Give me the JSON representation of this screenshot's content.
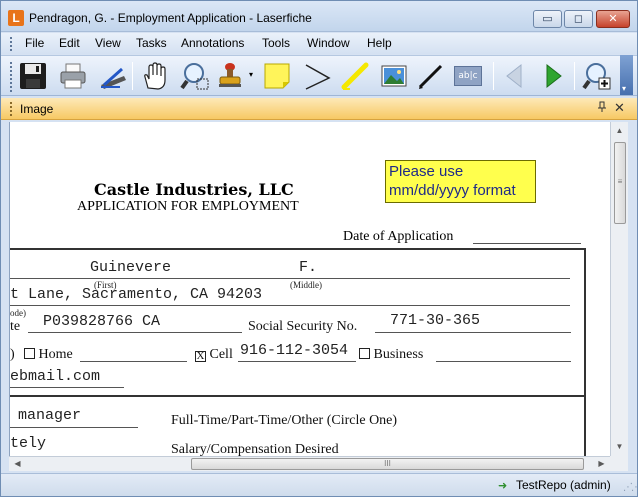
{
  "window": {
    "app_icon_letter": "L",
    "title": "Pendragon, G. - Employment Application - Laserfiche",
    "minimize_glyph": "▭",
    "maximize_glyph": "◻",
    "close_glyph": "✕"
  },
  "menu": {
    "items": [
      "File",
      "Edit",
      "View",
      "Tasks",
      "Annotations",
      "Tools",
      "Window",
      "Help"
    ]
  },
  "toolbar": {
    "tools": [
      "save-icon",
      "print-icon",
      "scan-icon",
      "pan-hand-icon",
      "zoom-rect-icon",
      "stamp-icon",
      "sticky-note-icon",
      "pointer-arrow-icon",
      "highlighter-icon",
      "image-icon",
      "pen-icon",
      "text-box-icon",
      "previous-page-icon",
      "next-page-icon",
      "zoom-in-icon"
    ],
    "textbox_glyph": "ab|c",
    "overflow_glyph": "▾"
  },
  "panel": {
    "title": "Image",
    "pin_glyph": "📌",
    "close_glyph": "✕"
  },
  "document": {
    "company": "Castle Industries, LLC",
    "subtitle": "APPLICATION FOR EMPLOYMENT",
    "date_label": "Date of Application",
    "first_name": "Guinevere",
    "middle_initial": "F.",
    "first_label": "(First)",
    "middle_label": "(Middle)",
    "address": "t Lane, Sacramento, CA 94203",
    "code_label": "ode)",
    "license_prefix": "te",
    "license_number": "P039828766 CA",
    "ssn_label": "Social Security No.",
    "ssn_value": "771-30-365",
    "phone_paren": ")",
    "home_label": "Home",
    "cell_check": "X",
    "cell_label": "Cell",
    "cell_number": "916-112-3054",
    "business_label": "Business",
    "email_fragment": "ebmail.com",
    "position": "manager",
    "employment_type_label": "Full-Time/Part-Time/Other (Circle One)",
    "start": "tely",
    "salary_label": "Salary/Compensation Desired",
    "sticky_note": "Please use mm/dd/yyyy format"
  },
  "scrollbars": {
    "up": "▲",
    "down": "▼",
    "left": "◀",
    "right": "▶",
    "grip_v": "≡",
    "grip_h": "III"
  },
  "status": {
    "repo_icon": "➜",
    "repository": "TestRepo (admin)",
    "grip": "⋰⋰"
  },
  "colors": {
    "title_gradient": "#c2d5ec",
    "panel_header": "#f7c964",
    "sticky_note": "#ffff4d",
    "sticky_text": "#1f2a88",
    "next_arrow": "#2fa52f"
  }
}
